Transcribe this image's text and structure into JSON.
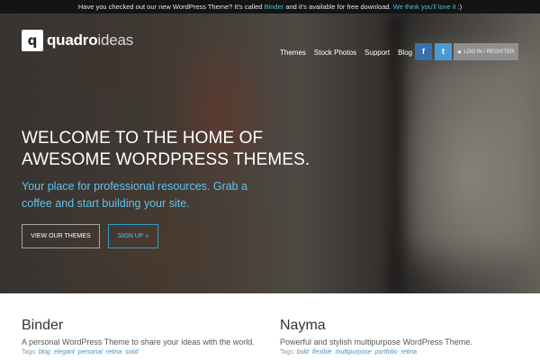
{
  "announcement": {
    "text_before": "Have you checked out our new WordPress Theme? It's called ",
    "link_binder": "Binder",
    "text_after": " and it's available for free download. ",
    "link_love": "We think you'll love it",
    "smiley": " :)"
  },
  "logo": {
    "mark": "q",
    "word1": "quadro",
    "word2": "ideas"
  },
  "nav": {
    "items": [
      "Themes",
      "Stock Photos",
      "Support",
      "Blog"
    ],
    "facebook_icon": "facebook-icon",
    "twitter_icon": "twitter-icon",
    "facebook_glyph": "f",
    "twitter_glyph": "t",
    "login_icon": "lock-icon",
    "login_label": "LOG IN / REGISTER"
  },
  "hero": {
    "headline_line1": "WELCOME TO THE HOME OF",
    "headline_line2": "AWESOME WORDPRESS THEMES.",
    "sub_line1": "Your place for professional resources. Grab a",
    "sub_line2": "coffee and start building your site.",
    "btn_themes": "VIEW OUR THEMES",
    "btn_signup": "SIGN UP »"
  },
  "cards": [
    {
      "title": "Binder",
      "description": "A personal WordPress Theme to share your ideas with the world.",
      "tags_label": "Tags:",
      "tags": [
        "blog",
        "elegant",
        "personal",
        "retina",
        "solid"
      ]
    },
    {
      "title": "Nayma",
      "description": "Powerful and stylish multipurpose WordPress Theme.",
      "tags_label": "Tags:",
      "tags": [
        "bold",
        "flexible",
        "multipurpose",
        "portfolio",
        "retina"
      ]
    }
  ],
  "colors": {
    "accent_blue": "#5ec4ec",
    "announce_bg": "#141414",
    "facebook": "#3a6fa8",
    "twitter": "#4a9cd0"
  }
}
